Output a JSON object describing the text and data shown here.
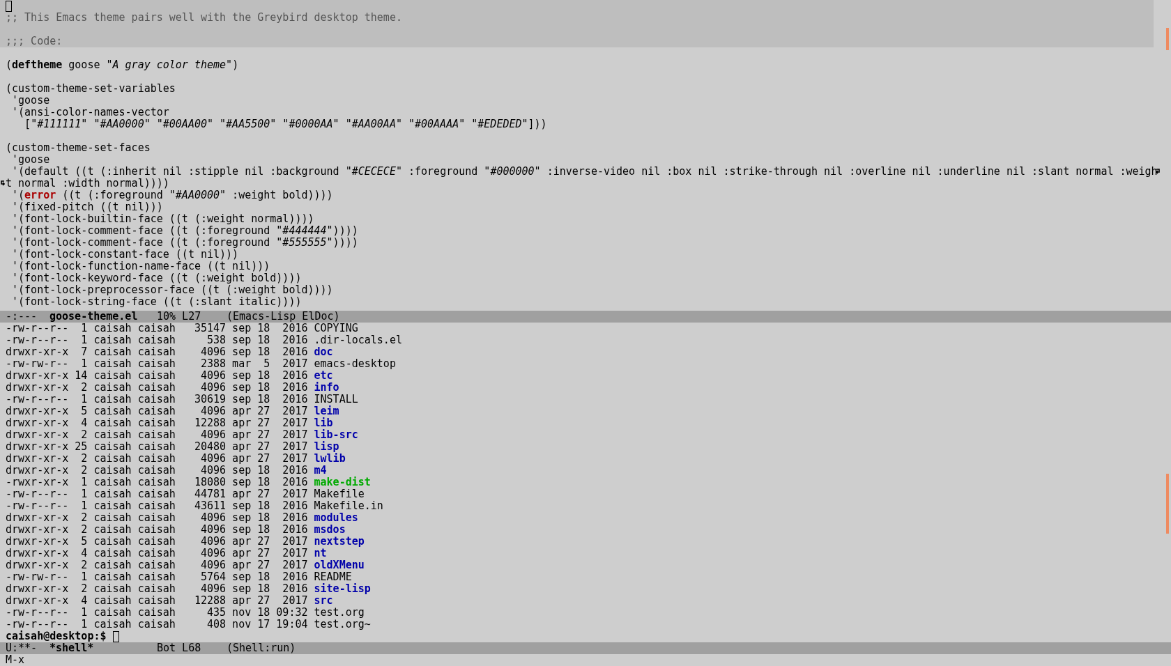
{
  "editor": {
    "banner": {
      "cursor": true,
      "blocks": [
        [
          {
            "segments": [
              {
                "kind": "comment",
                "text": ";; This Emacs theme pairs well with the Greybird desktop theme."
              }
            ]
          }
        ],
        [
          {
            "segments": [
              {
                "kind": "comment",
                "text": ";;; Code:"
              }
            ]
          }
        ]
      ]
    },
    "blocks": [
      [
        {
          "segments": [
            {
              "kind": "plain",
              "text": "("
            },
            {
              "kind": "keyword",
              "text": "deftheme"
            },
            {
              "kind": "plain",
              "text": " goose "
            },
            {
              "kind": "string",
              "text": "\"A gray color theme\""
            },
            {
              "kind": "plain",
              "text": ")"
            }
          ]
        }
      ],
      [
        {
          "segments": [
            {
              "kind": "plain",
              "text": "(custom-theme-set-variables"
            }
          ]
        },
        {
          "segments": [
            {
              "kind": "plain",
              "text": " 'goose"
            }
          ]
        },
        {
          "segments": [
            {
              "kind": "plain",
              "text": " '(ansi-color-names-vector"
            }
          ]
        },
        {
          "segments": [
            {
              "kind": "plain",
              "text": "   ["
            },
            {
              "kind": "string",
              "text": "\"#111111\" \"#AA0000\" \"#00AA00\" \"#AA5500\" \"#0000AA\" \"#AA00AA\" \"#00AAAA\" \"#EDEDED\""
            },
            {
              "kind": "plain",
              "text": "]))"
            }
          ]
        }
      ],
      [
        {
          "segments": [
            {
              "kind": "plain",
              "text": "(custom-theme-set-faces"
            }
          ]
        },
        {
          "segments": [
            {
              "kind": "plain",
              "text": " 'goose"
            }
          ]
        },
        {
          "continues": true,
          "segments": [
            {
              "kind": "plain",
              "text": " '(default ((t (:inherit nil :stipple nil :background "
            },
            {
              "kind": "string",
              "text": "\"#CECECE\""
            },
            {
              "kind": "plain",
              "text": " :foreground "
            },
            {
              "kind": "string",
              "text": "\"#000000\""
            },
            {
              "kind": "plain",
              "text": " :inverse-video nil :box nil :strike-through nil :overline nil :underline nil :slant normal :weigh"
            }
          ]
        },
        {
          "continued": true,
          "segments": [
            {
              "kind": "plain",
              "text": "t normal :width normal))))"
            }
          ]
        },
        {
          "segments": [
            {
              "kind": "plain",
              "text": " '("
            },
            {
              "kind": "error",
              "text": "error"
            },
            {
              "kind": "plain",
              "text": " ((t (:foreground "
            },
            {
              "kind": "string",
              "text": "\"#AA0000\""
            },
            {
              "kind": "plain",
              "text": " :weight bold))))"
            }
          ]
        },
        {
          "segments": [
            {
              "kind": "plain",
              "text": " '(fixed-pitch ((t nil)))"
            }
          ]
        },
        {
          "segments": [
            {
              "kind": "plain",
              "text": " '(font-lock-builtin-face ((t (:weight normal))))"
            }
          ]
        },
        {
          "segments": [
            {
              "kind": "plain",
              "text": " '(font-lock-comment-face ((t (:foreground "
            },
            {
              "kind": "string",
              "text": "\"#444444\""
            },
            {
              "kind": "plain",
              "text": "))))"
            }
          ]
        },
        {
          "segments": [
            {
              "kind": "plain",
              "text": " '(font-lock-comment-face ((t (:foreground "
            },
            {
              "kind": "string",
              "text": "\"#555555\""
            },
            {
              "kind": "plain",
              "text": "))))"
            }
          ]
        },
        {
          "segments": [
            {
              "kind": "plain",
              "text": " '(font-lock-constant-face ((t nil)))"
            }
          ]
        },
        {
          "segments": [
            {
              "kind": "plain",
              "text": " '(font-lock-function-name-face ((t nil)))"
            }
          ]
        },
        {
          "segments": [
            {
              "kind": "plain",
              "text": " '(font-lock-keyword-face ((t (:weight bold))))"
            }
          ]
        },
        {
          "segments": [
            {
              "kind": "plain",
              "text": " '(font-lock-preprocessor-face ((t (:weight bold))))"
            }
          ]
        },
        {
          "segments": [
            {
              "kind": "plain",
              "text": " '(font-lock-string-face ((t (:slant italic))))"
            }
          ]
        }
      ]
    ],
    "mode_line": {
      "state": "-:---",
      "buffer": "goose-theme.el",
      "position": "10% L27",
      "modes": "(Emacs-Lisp ElDoc)"
    }
  },
  "shell": {
    "rows": [
      {
        "meta": "-rw-r--r--  1 caisah caisah   35147 sep 18  2016",
        "name": "COPYING",
        "kind": "file"
      },
      {
        "meta": "-rw-r--r--  1 caisah caisah     538 sep 18  2016",
        "name": ".dir-locals.el",
        "kind": "file"
      },
      {
        "meta": "drwxr-xr-x  7 caisah caisah    4096 sep 18  2016",
        "name": "doc",
        "kind": "dir"
      },
      {
        "meta": "-rw-rw-r--  1 caisah caisah    2388 mar  5  2017",
        "name": "emacs-desktop",
        "kind": "file"
      },
      {
        "meta": "drwxr-xr-x 14 caisah caisah    4096 sep 18  2016",
        "name": "etc",
        "kind": "dir"
      },
      {
        "meta": "drwxr-xr-x  2 caisah caisah    4096 sep 18  2016",
        "name": "info",
        "kind": "dir"
      },
      {
        "meta": "-rw-r--r--  1 caisah caisah   30619 sep 18  2016",
        "name": "INSTALL",
        "kind": "file"
      },
      {
        "meta": "drwxr-xr-x  5 caisah caisah    4096 apr 27  2017",
        "name": "leim",
        "kind": "dir"
      },
      {
        "meta": "drwxr-xr-x  4 caisah caisah   12288 apr 27  2017",
        "name": "lib",
        "kind": "dir"
      },
      {
        "meta": "drwxr-xr-x  2 caisah caisah    4096 apr 27  2017",
        "name": "lib-src",
        "kind": "dir"
      },
      {
        "meta": "drwxr-xr-x 25 caisah caisah   20480 apr 27  2017",
        "name": "lisp",
        "kind": "dir"
      },
      {
        "meta": "drwxr-xr-x  2 caisah caisah    4096 apr 27  2017",
        "name": "lwlib",
        "kind": "dir"
      },
      {
        "meta": "drwxr-xr-x  2 caisah caisah    4096 sep 18  2016",
        "name": "m4",
        "kind": "dir"
      },
      {
        "meta": "-rwxr-xr-x  1 caisah caisah   18080 sep 18  2016",
        "name": "make-dist",
        "kind": "exec"
      },
      {
        "meta": "-rw-r--r--  1 caisah caisah   44781 apr 27  2017",
        "name": "Makefile",
        "kind": "file"
      },
      {
        "meta": "-rw-r--r--  1 caisah caisah   43611 sep 18  2016",
        "name": "Makefile.in",
        "kind": "file"
      },
      {
        "meta": "drwxr-xr-x  2 caisah caisah    4096 sep 18  2016",
        "name": "modules",
        "kind": "dir"
      },
      {
        "meta": "drwxr-xr-x  2 caisah caisah    4096 sep 18  2016",
        "name": "msdos",
        "kind": "dir"
      },
      {
        "meta": "drwxr-xr-x  5 caisah caisah    4096 apr 27  2017",
        "name": "nextstep",
        "kind": "dir"
      },
      {
        "meta": "drwxr-xr-x  4 caisah caisah    4096 apr 27  2017",
        "name": "nt",
        "kind": "dir"
      },
      {
        "meta": "drwxr-xr-x  2 caisah caisah    4096 apr 27  2017",
        "name": "oldXMenu",
        "kind": "dir"
      },
      {
        "meta": "-rw-rw-r--  1 caisah caisah    5764 sep 18  2016",
        "name": "README",
        "kind": "file"
      },
      {
        "meta": "drwxr-xr-x  2 caisah caisah    4096 sep 18  2016",
        "name": "site-lisp",
        "kind": "dir"
      },
      {
        "meta": "drwxr-xr-x  4 caisah caisah   12288 apr 27  2017",
        "name": "src",
        "kind": "dir"
      },
      {
        "meta": "-rw-r--r--  1 caisah caisah     435 nov 18 09:32",
        "name": "test.org",
        "kind": "file"
      },
      {
        "meta": "-rw-r--r--  1 caisah caisah     408 nov 17 19:04",
        "name": "test.org~",
        "kind": "file"
      }
    ],
    "prompt": "caisah@desktop:$",
    "mode_line": {
      "state": "U:**-",
      "buffer": "*shell*",
      "position": "Bot L68",
      "modes": "(Shell:run)"
    }
  },
  "minibuffer": "M-x"
}
